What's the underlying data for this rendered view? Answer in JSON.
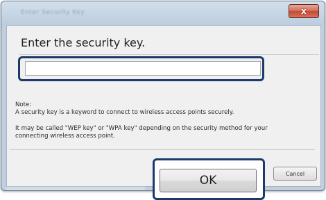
{
  "window": {
    "title": "Enter Security Key",
    "close_label": "x"
  },
  "dialog": {
    "heading": "Enter the security key.",
    "key_input": {
      "value": "",
      "placeholder": ""
    },
    "note_label": "Note:",
    "note_line1": "A security key is a keyword to connect to wireless access points securely.",
    "note_line2": "It may be called \"WEP key\" or \"WPA key\" depending on the security method for your",
    "note_line3": "connecting wireless access point."
  },
  "buttons": {
    "ok_label": "OK",
    "cancel_label": "Cancel"
  },
  "colors": {
    "highlight_frame": "#1b3a6b",
    "window_frame": "#bfcfdf",
    "close_button": "#c24a34"
  },
  "icons": {
    "close": "close-icon"
  }
}
